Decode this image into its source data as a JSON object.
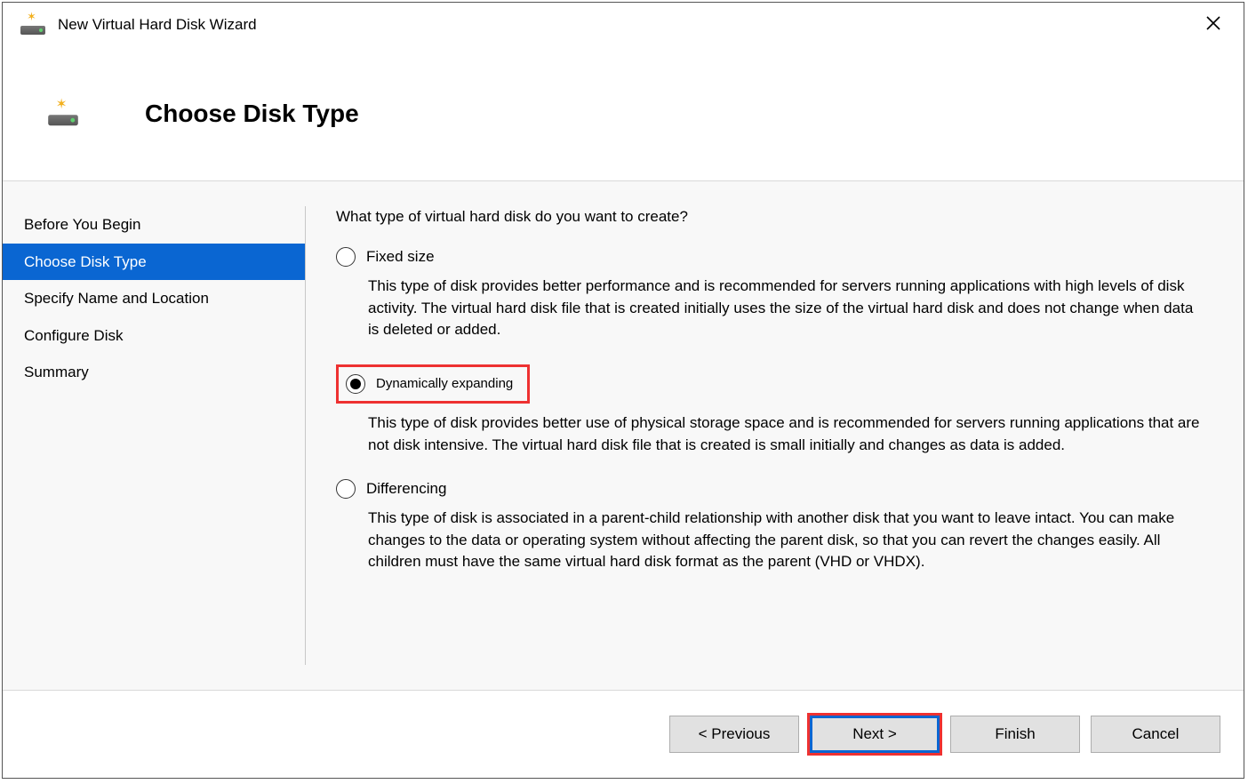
{
  "titlebar": {
    "title": "New Virtual Hard Disk Wizard"
  },
  "header": {
    "title": "Choose Disk Type"
  },
  "sidebar": {
    "items": [
      {
        "label": "Before You Begin"
      },
      {
        "label": "Choose Disk Type"
      },
      {
        "label": "Specify Name and Location"
      },
      {
        "label": "Configure Disk"
      },
      {
        "label": "Summary"
      }
    ]
  },
  "main": {
    "prompt": "What type of virtual hard disk do you want to create?",
    "options": [
      {
        "label": "Fixed size",
        "desc": "This type of disk provides better performance and is recommended for servers running applications with high levels of disk activity. The virtual hard disk file that is created initially uses the size of the virtual hard disk and does not change when data is deleted or added."
      },
      {
        "label": "Dynamically expanding",
        "desc": "This type of disk provides better use of physical storage space and is recommended for servers running applications that are not disk intensive. The virtual hard disk file that is created is small initially and changes as data is added."
      },
      {
        "label": "Differencing",
        "desc": "This type of disk is associated in a parent-child relationship with another disk that you want to leave intact. You can make changes to the data or operating system without affecting the parent disk, so that you can revert the changes easily. All children must have the same virtual hard disk format as the parent (VHD or VHDX)."
      }
    ]
  },
  "footer": {
    "previous": "< Previous",
    "next": "Next >",
    "finish": "Finish",
    "cancel": "Cancel"
  }
}
